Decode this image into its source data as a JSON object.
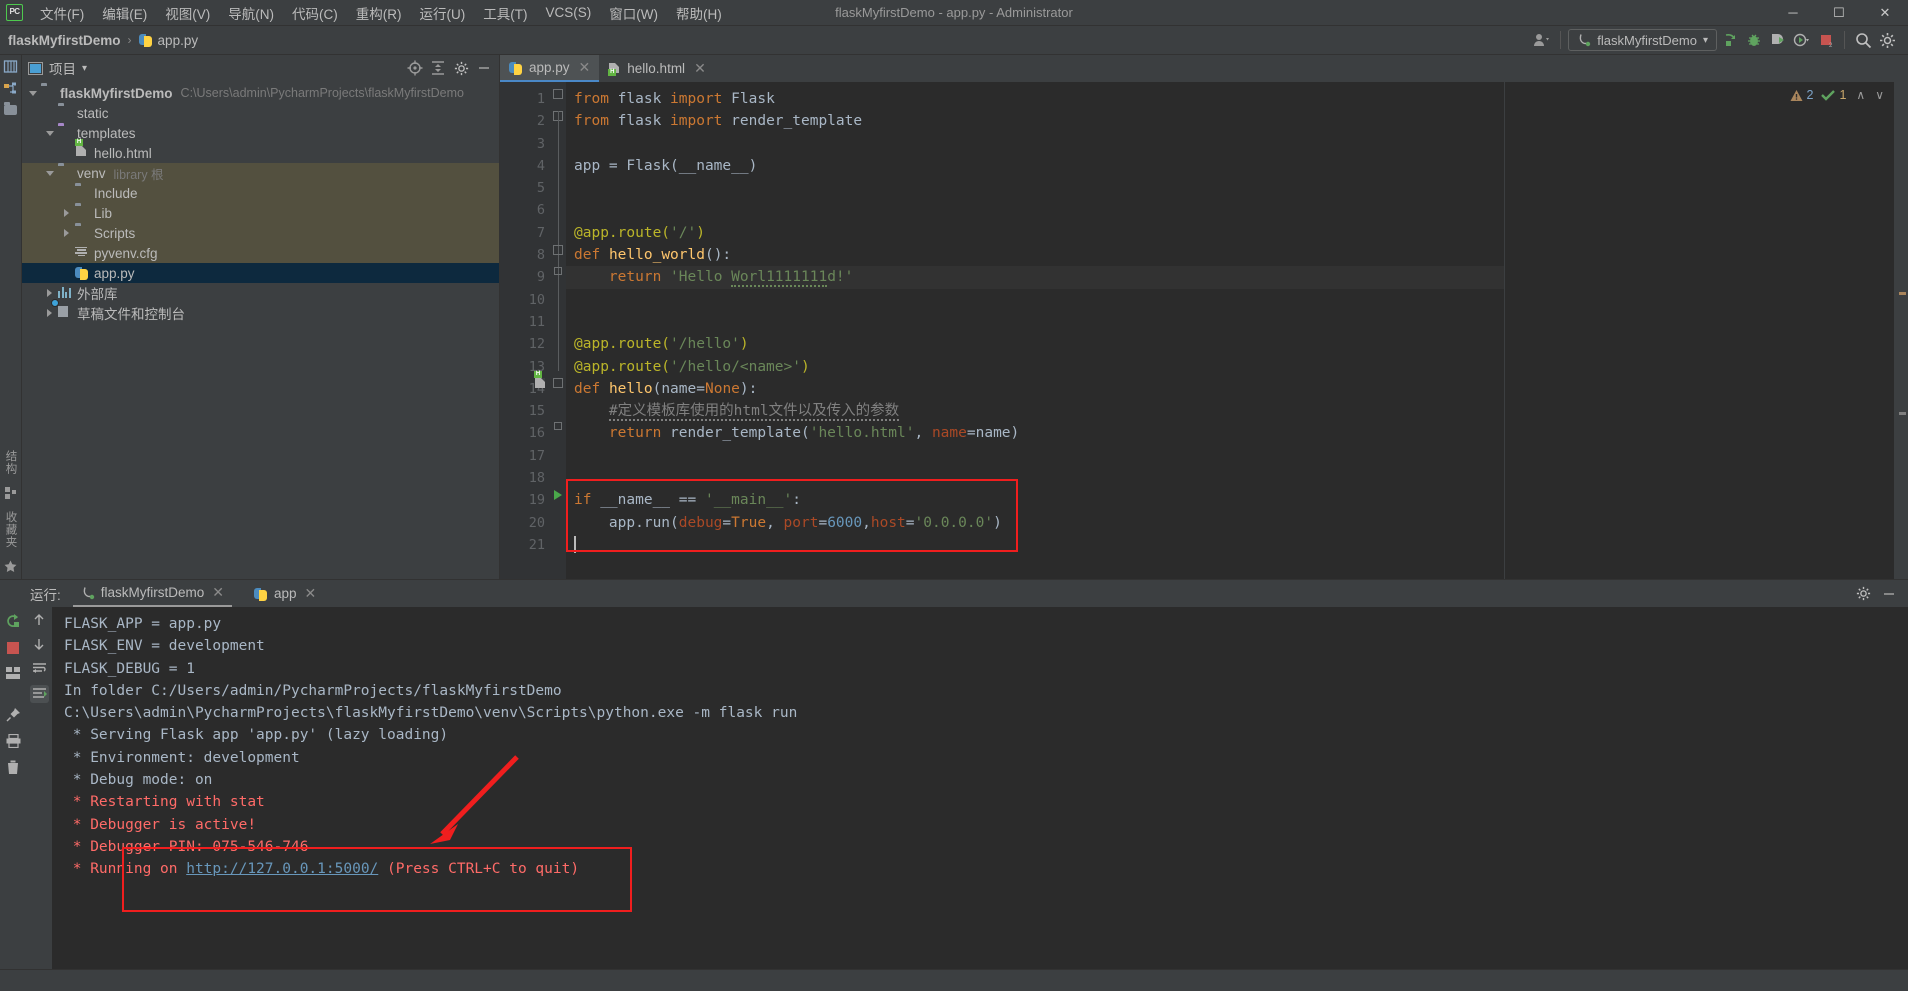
{
  "window": {
    "title": "flaskMyfirstDemo - app.py - Administrator",
    "logo_text": "PC",
    "minimize": "─",
    "maximize": "☐",
    "close": "✕"
  },
  "menubar": {
    "items": [
      {
        "label": "文件(F)",
        "name": "menu-file"
      },
      {
        "label": "编辑(E)",
        "name": "menu-edit"
      },
      {
        "label": "视图(V)",
        "name": "menu-view"
      },
      {
        "label": "导航(N)",
        "name": "menu-navigate"
      },
      {
        "label": "代码(C)",
        "name": "menu-code"
      },
      {
        "label": "重构(R)",
        "name": "menu-refactor"
      },
      {
        "label": "运行(U)",
        "name": "menu-run"
      },
      {
        "label": "工具(T)",
        "name": "menu-tools"
      },
      {
        "label": "VCS(S)",
        "name": "menu-vcs"
      },
      {
        "label": "窗口(W)",
        "name": "menu-window"
      },
      {
        "label": "帮助(H)",
        "name": "menu-help"
      }
    ]
  },
  "navbar": {
    "breadcrumb_project": "flaskMyfirstDemo",
    "breadcrumb_sep": "›",
    "breadcrumb_file": "app.py",
    "run_config": "flaskMyfirstDemo",
    "run_config_caret": "▾",
    "icons": [
      "user-dropdown-icon",
      "run-icon",
      "debug-icon",
      "run-coverage-icon",
      "profile-icon",
      "stop-icon",
      "search-icon",
      "settings-icon"
    ]
  },
  "left_rail": {
    "project_tool_label": "项目",
    "structure_label": "结构",
    "favorites_label": "收藏夹"
  },
  "project_panel": {
    "title": "项目",
    "caret": "▾",
    "tree": [
      {
        "name": "tree-item-project-root",
        "label": "flaskMyfirstDemo",
        "sub": "C:\\Users\\admin\\PycharmProjects\\flaskMyfirstDemo",
        "indent": 0,
        "twisty": "down",
        "icon": "folder",
        "bold": true,
        "state": "none"
      },
      {
        "name": "tree-item-static",
        "label": "static",
        "sub": "",
        "indent": 1,
        "twisty": "none",
        "icon": "folder",
        "bold": false,
        "state": "none"
      },
      {
        "name": "tree-item-templates",
        "label": "templates",
        "sub": "",
        "indent": 1,
        "twisty": "down",
        "icon": "folder-purple",
        "bold": false,
        "state": "none"
      },
      {
        "name": "tree-item-hello-html",
        "label": "hello.html",
        "sub": "",
        "indent": 2,
        "twisty": "none",
        "icon": "html",
        "bold": false,
        "state": "none"
      },
      {
        "name": "tree-item-venv",
        "label": "venv",
        "sub": "library 根",
        "indent": 1,
        "twisty": "down",
        "icon": "folder",
        "bold": false,
        "state": "venv"
      },
      {
        "name": "tree-item-include",
        "label": "Include",
        "sub": "",
        "indent": 2,
        "twisty": "none",
        "icon": "folder",
        "bold": false,
        "state": "venv"
      },
      {
        "name": "tree-item-lib",
        "label": "Lib",
        "sub": "",
        "indent": 2,
        "twisty": "right",
        "icon": "folder",
        "bold": false,
        "state": "venv"
      },
      {
        "name": "tree-item-scripts",
        "label": "Scripts",
        "sub": "",
        "indent": 2,
        "twisty": "right",
        "icon": "folder",
        "bold": false,
        "state": "venv"
      },
      {
        "name": "tree-item-pyvenv-cfg",
        "label": "pyvenv.cfg",
        "sub": "",
        "indent": 2,
        "twisty": "none",
        "icon": "cfg",
        "bold": false,
        "state": "venv"
      },
      {
        "name": "tree-item-app-py",
        "label": "app.py",
        "sub": "",
        "indent": 1,
        "twisty": "none",
        "icon": "python",
        "bold": false,
        "state": "selected"
      },
      {
        "name": "tree-item-external-libraries",
        "label": "外部库",
        "sub": "",
        "indent": 0,
        "twisty": "right",
        "icon": "lib",
        "bold": false,
        "state": "none"
      },
      {
        "name": "tree-item-scratches",
        "label": "草稿文件和控制台",
        "sub": "",
        "indent": 0,
        "twisty": "right",
        "icon": "scratch",
        "bold": false,
        "state": "none"
      }
    ]
  },
  "editor": {
    "tabs": [
      {
        "label": "app.py",
        "icon": "python-file-icon",
        "active": true,
        "close": "✕"
      },
      {
        "label": "hello.html",
        "icon": "html-file-icon",
        "active": false,
        "close": "✕"
      }
    ],
    "inspection": {
      "warning_count": "2",
      "check_count": "1",
      "up": "∧",
      "down": "∨"
    },
    "line_numbers": [
      "1",
      "2",
      "3",
      "4",
      "5",
      "6",
      "7",
      "8",
      "9",
      "10",
      "11",
      "12",
      "13",
      "14",
      "15",
      "16",
      "17",
      "18",
      "19",
      "20",
      "21"
    ],
    "code_lines": [
      "from flask import Flask",
      "from flask import render_template",
      "",
      "app = Flask(__name__)",
      "",
      "",
      "@app.route('/')",
      "def hello_world():",
      "    return 'Hello Worl1111111d!'",
      "",
      "",
      "@app.route('/hello')",
      "@app.route('/hello/<name>')",
      "def hello(name=None):",
      "    #定义模板库使用的html文件以及传入的参数",
      "    return render_template('hello.html', name=name)",
      "",
      "",
      "if __name__ == '__main__':",
      "    app.run(debug=True, port=6000,host='0.0.0.0')",
      ""
    ]
  },
  "run_panel": {
    "label": "运行:",
    "tabs": [
      {
        "label": "flaskMyfirstDemo",
        "icon": "flask-run-icon",
        "active": true,
        "close": "✕"
      },
      {
        "label": "app",
        "icon": "python-run-icon",
        "active": false,
        "close": "✕"
      }
    ],
    "settings_icon": "gear-icon",
    "hide_icon": "minimize-icon",
    "console_lines": [
      {
        "text": "FLASK_APP = app.py",
        "error": false
      },
      {
        "text": "FLASK_ENV = development",
        "error": false
      },
      {
        "text": "FLASK_DEBUG = 1",
        "error": false
      },
      {
        "text": "In folder C:/Users/admin/PycharmProjects/flaskMyfirstDemo",
        "error": false
      },
      {
        "text": "C:\\Users\\admin\\PycharmProjects\\flaskMyfirstDemo\\venv\\Scripts\\python.exe -m flask run",
        "error": false
      },
      {
        "text": " * Serving Flask app 'app.py' (lazy loading)",
        "error": false
      },
      {
        "text": " * Environment: development",
        "error": false
      },
      {
        "text": " * Debug mode: on",
        "error": false
      },
      {
        "text": " * Restarting with stat",
        "error": true
      },
      {
        "text": " * Debugger is active!",
        "error": true
      },
      {
        "text": " * Debugger PIN: 075-546-746",
        "error": true
      }
    ],
    "running_line": {
      "prefix": " * Running on ",
      "url": "http://127.0.0.1:5000/",
      "suffix": " (Press CTRL+C to quit)"
    }
  },
  "annotations": {
    "highlight_color": "#f01e1e",
    "code_box_name": "code-highlight-box",
    "console_box_name": "console-highlight-box",
    "arrow_name": "red-arrow-annotation"
  },
  "colors": {
    "bg_chrome": "#3c3f41",
    "bg_editor": "#2b2b2b",
    "accent_blue": "#4a88c7",
    "selection": "#0d293e",
    "venv_row": "#53503f",
    "keyword": "#cc7832",
    "string": "#6a8759",
    "number": "#6897bb",
    "decorator": "#bbb529",
    "function": "#ffc66d",
    "comment": "#808080",
    "param": "#aa4926",
    "error_text": "#ff6b68"
  }
}
